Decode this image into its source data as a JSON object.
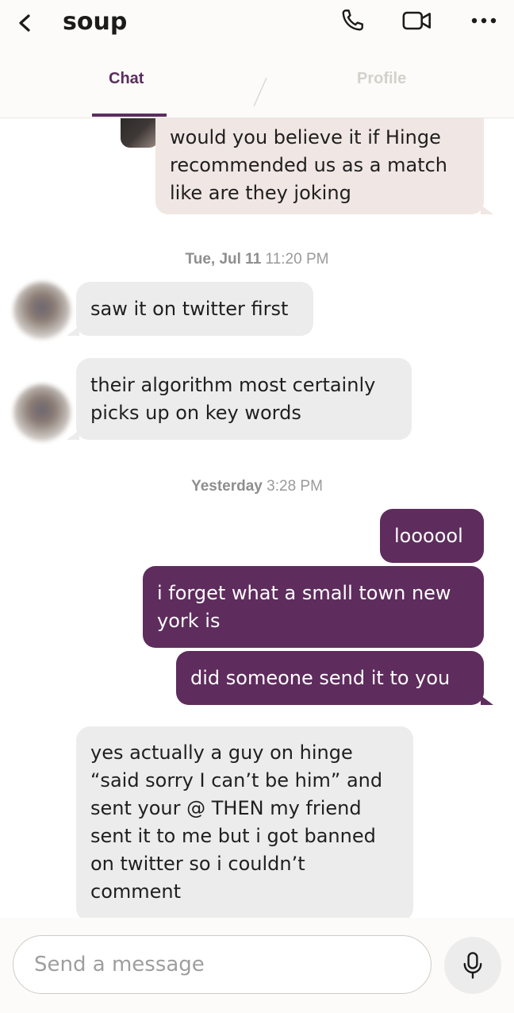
{
  "header": {
    "title": "soup",
    "tabs": [
      {
        "label": "Chat",
        "active": true
      },
      {
        "label": "Profile",
        "active": false
      }
    ],
    "accent_color": "#5e2c5d"
  },
  "messages": {
    "partial_outgoing": "would you believe it if Hinge\nrecommended us as a match\nlike are they joking",
    "ts1_day": "Tue, Jul 11",
    "ts1_time": "11:20 PM",
    "in1": "saw it on twitter first",
    "in2": "their algorithm most certainly\npicks up on key words",
    "ts2_day": "Yesterday",
    "ts2_time": "3:28 PM",
    "out1": "loooool",
    "out2": "i forget what a small town new\nyork is",
    "out3": "did someone send it to you",
    "in3": "yes actually a guy on hinge\n“said sorry I can’t be him” and\nsent your @ THEN my friend\nsent it to me but i got banned\non twitter so i couldn’t\ncomment"
  },
  "composer": {
    "placeholder": "Send a message"
  }
}
